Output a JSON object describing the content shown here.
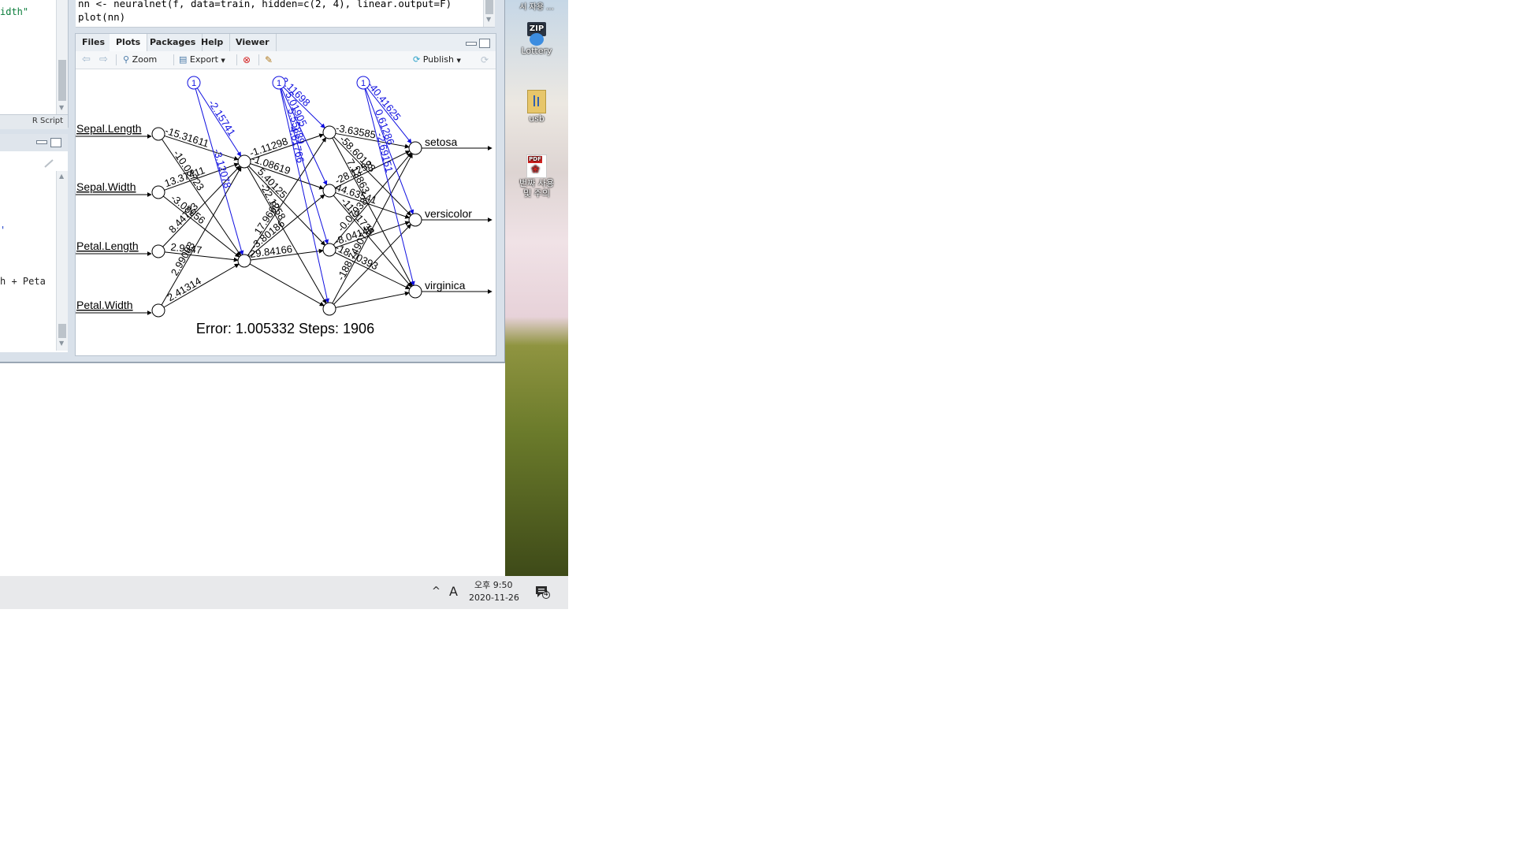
{
  "editor": {
    "line1": "nn <- neuralnet(f, data=train, hidden=c(2, 4), linear.output=F)",
    "line2": "plot(nn)",
    "left_fragment": "idth\"",
    "file_type": "R Script"
  },
  "console": {
    "fragment_1": "'",
    "fragment_2": "h + Peta"
  },
  "plots_pane": {
    "tabs": [
      "Files",
      "Plots",
      "Packages",
      "Help",
      "Viewer"
    ],
    "active_tab": "Plots",
    "toolbar": {
      "zoom": "Zoom",
      "export": "Export",
      "publish": "Publish"
    }
  },
  "desktop_icons": [
    {
      "label": "Lottery",
      "icon": "zip-archive-icon",
      "badge": "ZIP"
    },
    {
      "label": "usb",
      "icon": "usb-drive-icon"
    },
    {
      "label": "번짜 사용\n및 주의",
      "icon": "pdf-file-icon",
      "badge": "PDF"
    }
  ],
  "desktop_top_fragment": "시 자용 ...",
  "taskbar": {
    "ime": "A",
    "time": "오후 9:50",
    "date": "2020-11-26",
    "notifications": "4"
  },
  "chart_data": {
    "type": "network",
    "inputs": [
      "Sepal.Length",
      "Sepal.Width",
      "Petal.Length",
      "Petal.Width"
    ],
    "hidden1_size": 2,
    "hidden2_size": 4,
    "outputs": [
      "setosa",
      "versicolor",
      "virginica"
    ],
    "bias_label": "1",
    "input_hidden1_weights": [
      "-15.31611",
      "-10.08723",
      "13.37411",
      "-3.08956",
      "8.44723",
      "2.9347",
      "2.99083",
      "2.41314"
    ],
    "hidden1_hidden2_weights": [
      "-1.11298",
      "-1.08619",
      "5.40125",
      "-22.1258",
      "17.9668",
      "-3.80186",
      "-29.84166"
    ],
    "hidden2_output_weights": [
      "-3.63585",
      "-58.60123",
      "7.13863",
      "-28.1258",
      "44.63541",
      "-11.91738",
      "-0.07938",
      "-8.04146",
      "-18.70393",
      "-188.74907"
    ],
    "bias_weights": [
      "-2.15741",
      "-3.12078",
      "3.11698",
      "5.01905",
      "5.55889",
      "-4.61766",
      "-40.41625",
      "0.61286",
      "-2.69151"
    ],
    "footer": "Error: 1.005332   Steps: 1906"
  }
}
